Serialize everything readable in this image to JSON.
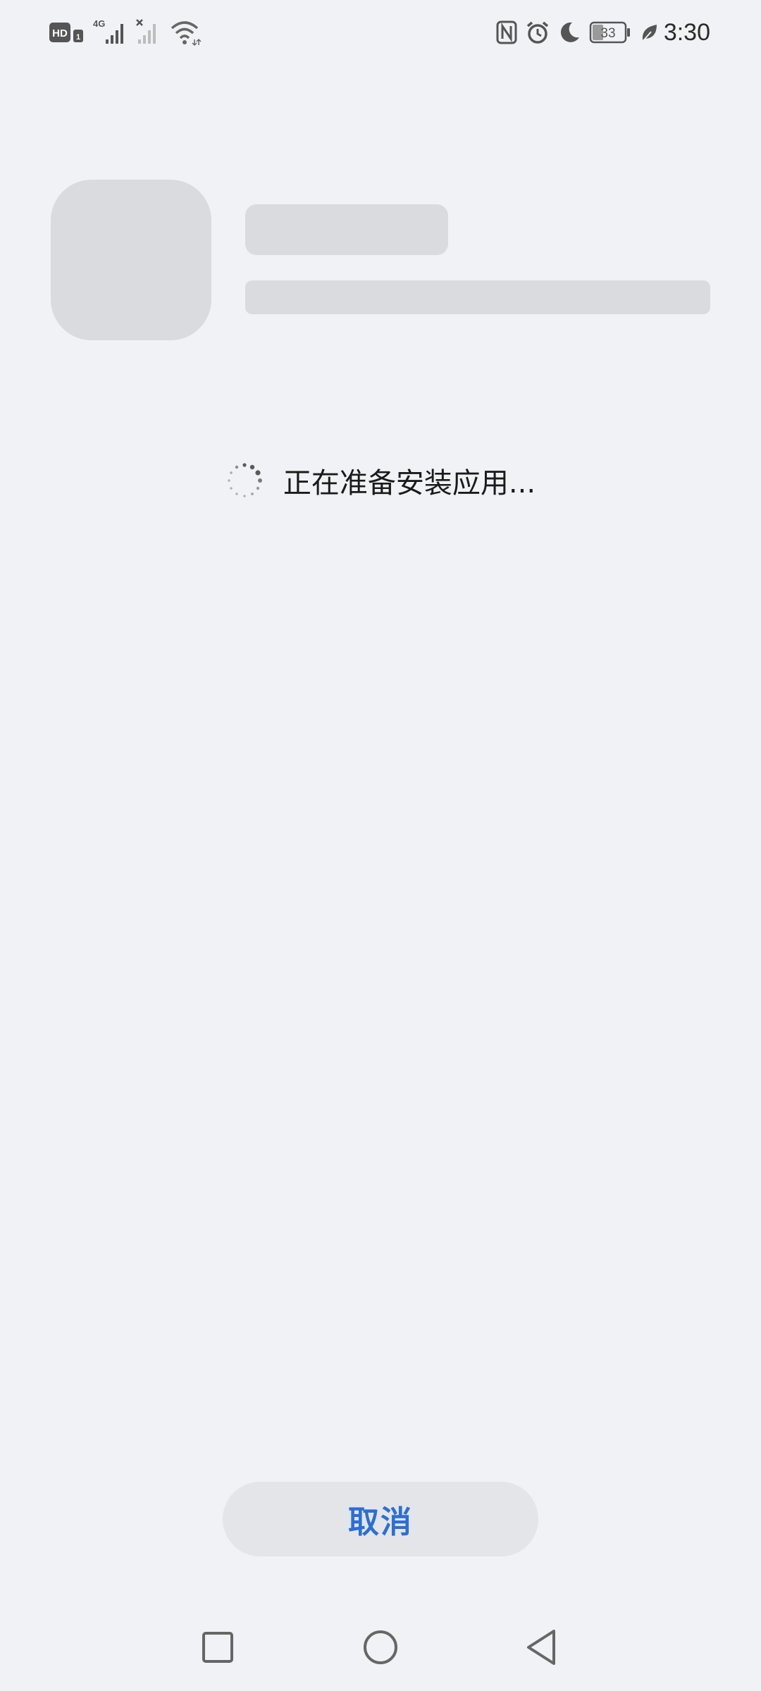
{
  "status_bar": {
    "left_icons": [
      "hd-icon",
      "sim-1-icon",
      "4g-signal-icon",
      "no-signal-icon",
      "wifi-icon"
    ],
    "hd_label": "HD",
    "sim_slot_label": "1",
    "network_label": "4G",
    "right_icons": [
      "nfc-icon",
      "alarm-icon",
      "do-not-disturb-moon-icon",
      "battery-icon",
      "battery-saver-leaf-icon"
    ],
    "battery_level": "33",
    "time": "3:30"
  },
  "install": {
    "loading_text": "正在准备安装应用..."
  },
  "actions": {
    "cancel_label": "取消"
  },
  "nav_bar": {
    "items": [
      "recents-square-icon",
      "home-circle-icon",
      "back-triangle-icon"
    ]
  },
  "colors": {
    "background": "#f1f2f6",
    "placeholder": "#dadbdf",
    "button_bg": "#e4e5e9",
    "accent": "#2b6fd6",
    "text": "#1b1b1b"
  }
}
